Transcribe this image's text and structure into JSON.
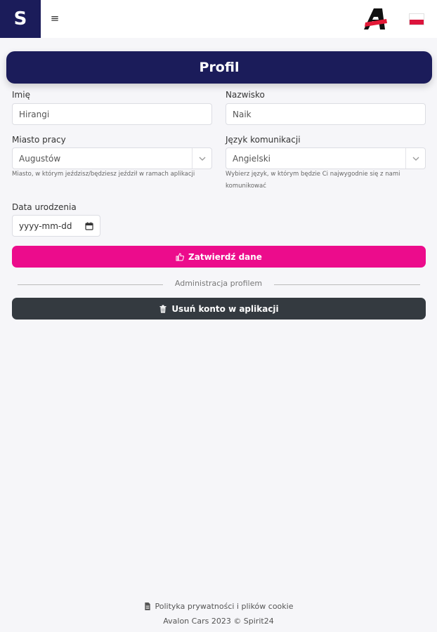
{
  "header": {
    "logo_letter": "S",
    "menu_icon": "hamburger-icon",
    "brand_icon": "avalon-logo-icon",
    "language_flag": "poland-flag-icon"
  },
  "page": {
    "title": "Profil"
  },
  "form": {
    "first_name": {
      "label": "Imię",
      "value": "Hirangi"
    },
    "last_name": {
      "label": "Nazwisko",
      "value": "Naik"
    },
    "city": {
      "label": "Miasto pracy",
      "value": "Augustów",
      "hint": "Miasto, w którym jeździsz/będziesz jeździł w ramach aplikacji"
    },
    "language": {
      "label": "Język komunikacji",
      "value": "Angielski",
      "hint_line1": "Wybierz język, w którym będzie Ci najwygodnie się z nami",
      "hint_line2": "komunikować"
    },
    "birth_date": {
      "label": "Data urodzenia",
      "placeholder": "yyyy-mm-dd"
    },
    "submit_label": "Zatwierdź dane"
  },
  "admin": {
    "divider_label": "Administracja profilem",
    "delete_label": "Usuń konto w aplikacji"
  },
  "footer": {
    "policy_label": "Polityka prywatności i plików cookie",
    "copyright": "Avalon Cars 2023 © Spirit24"
  },
  "colors": {
    "primary": "#1b1c5a",
    "accent": "#ec0c8c",
    "dark_button": "#343a40",
    "background": "#f6f6f9"
  }
}
